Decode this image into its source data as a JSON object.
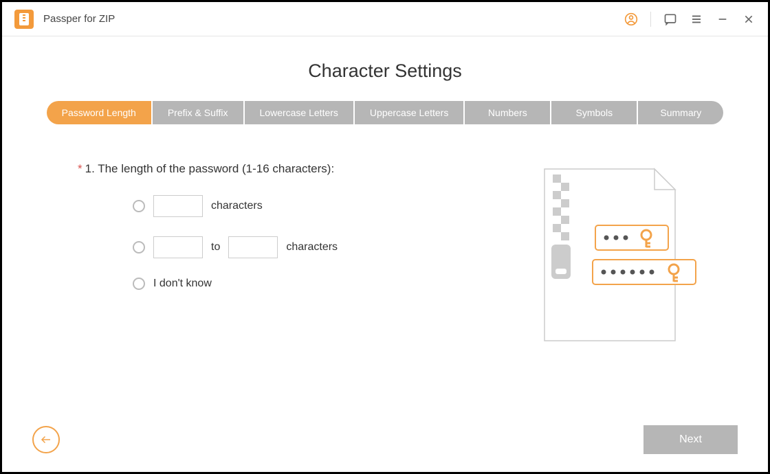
{
  "app": {
    "title": "Passper for ZIP"
  },
  "page": {
    "title": "Character Settings"
  },
  "tabs": [
    {
      "label": "Password Length",
      "active": true
    },
    {
      "label": "Prefix & Suffix",
      "active": false
    },
    {
      "label": "Lowercase Letters",
      "active": false
    },
    {
      "label": "Uppercase Letters",
      "active": false
    },
    {
      "label": "Numbers",
      "active": false
    },
    {
      "label": "Symbols",
      "active": false
    },
    {
      "label": "Summary",
      "active": false
    }
  ],
  "question": {
    "required_marker": "*",
    "text": "1. The length of the password (1-16 characters):"
  },
  "options": {
    "exact": {
      "value": "",
      "suffix": "characters"
    },
    "range": {
      "from": "",
      "to": "",
      "joiner": "to",
      "suffix": "characters"
    },
    "unknown": {
      "label": "I don't know"
    }
  },
  "buttons": {
    "next": "Next"
  },
  "colors": {
    "accent": "#f3a34a",
    "grey": "#b6b6b6"
  }
}
